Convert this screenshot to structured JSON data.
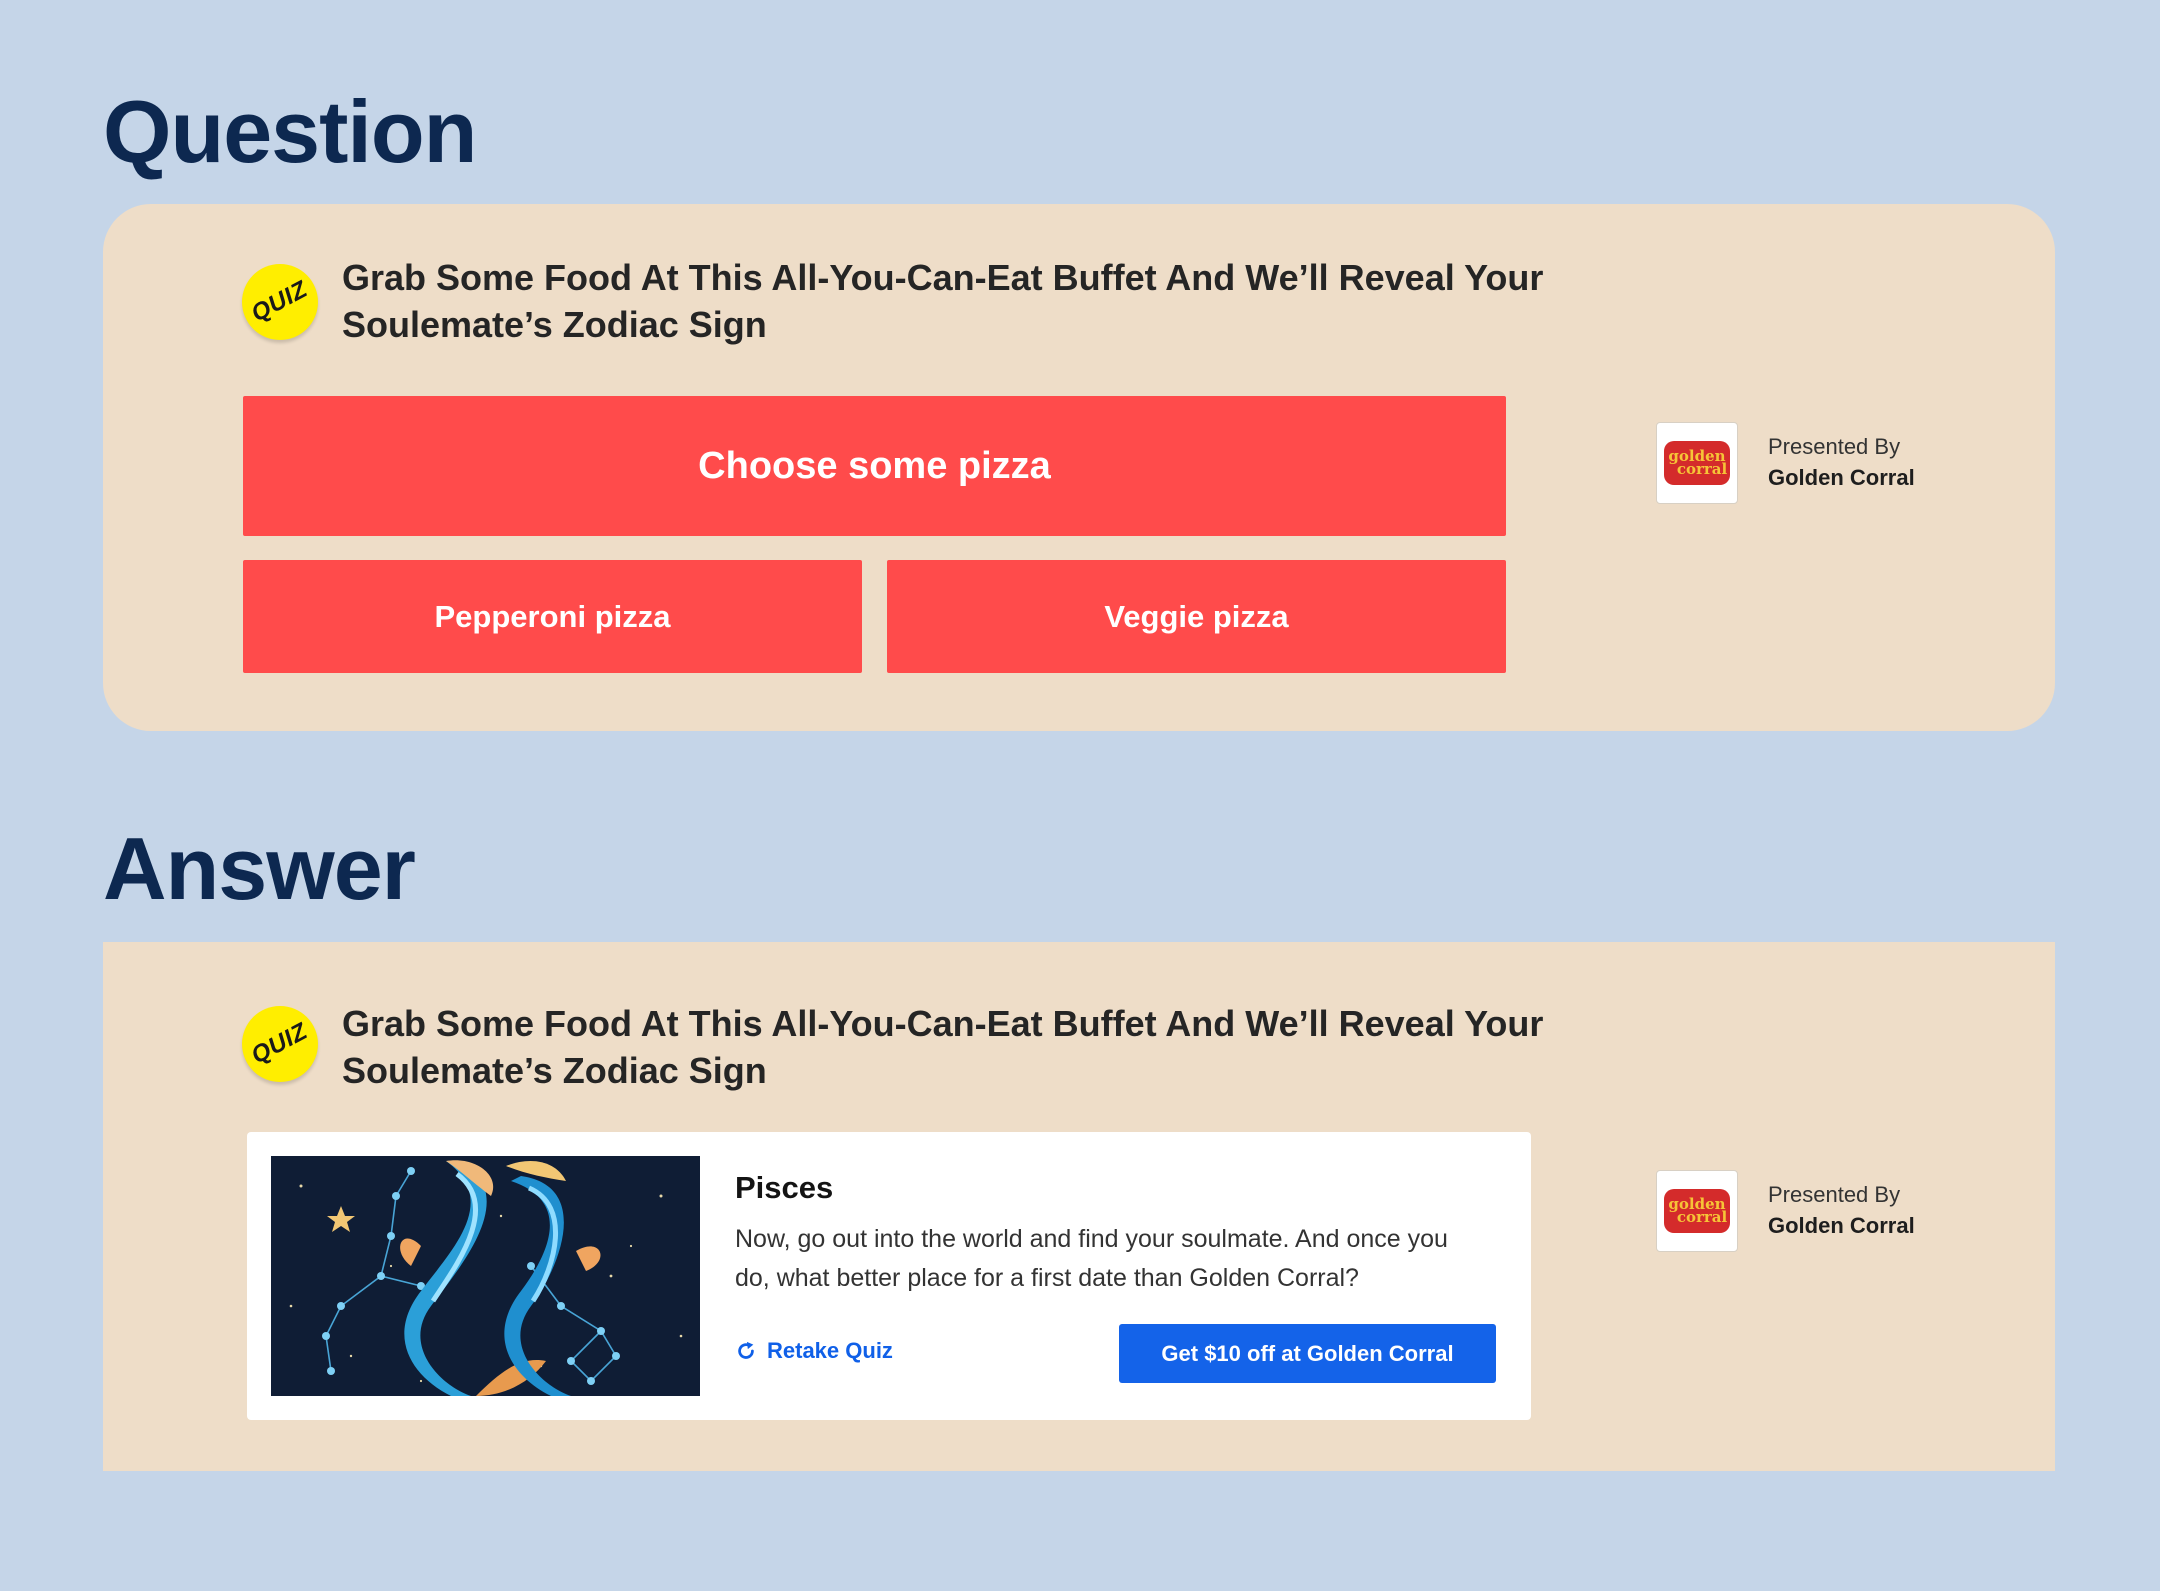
{
  "sections": {
    "question_title": "Question",
    "answer_title": "Answer"
  },
  "quiz": {
    "badge": "QUIZ",
    "headline": "Grab Some Food At This All-You-Can-Eat Buffet And We’ll Reveal Your Soulemate’s Zodiac Sign"
  },
  "question": {
    "prompt_button": "Choose some pizza",
    "options": [
      "Pepperoni pizza",
      "Veggie pizza"
    ]
  },
  "sponsor": {
    "label": "Presented By",
    "name": "Golden Corral",
    "logo_line1": "golden",
    "logo_line2": "corral"
  },
  "answer": {
    "result_title": "Pisces",
    "result_text": "Now, go out into the world and find your soulmate. And once you do, what better place for a first date than Golden Corral?",
    "retake_label": "Retake Quiz",
    "cta_label": "Get $10 off at Golden Corral"
  },
  "colors": {
    "page_bg": "#c5d5e8",
    "panel_bg": "#eeddc8",
    "option_red": "#ff4b4b",
    "cta_blue": "#1463e9",
    "badge_yellow": "#ffee00",
    "title_navy": "#0d2850"
  },
  "icons": {
    "badge": "quiz-badge-icon",
    "retake": "refresh-icon",
    "sponsor_logo": "golden-corral-logo"
  }
}
